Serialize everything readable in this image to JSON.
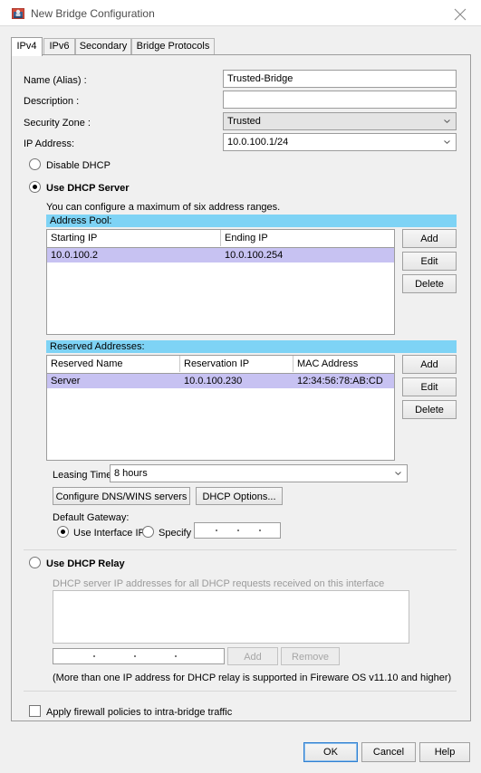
{
  "window": {
    "title": "New Bridge Configuration",
    "icon": "bridge-app-icon",
    "close_icon": "close-icon"
  },
  "tabs": [
    {
      "label": "IPv4",
      "active": true
    },
    {
      "label": "IPv6",
      "active": false
    },
    {
      "label": "Secondary",
      "active": false
    },
    {
      "label": "Bridge Protocols",
      "active": false
    }
  ],
  "form": {
    "name_label": "Name (Alias) :",
    "name_value": "Trusted-Bridge",
    "description_label": "Description :",
    "description_value": "",
    "security_zone_label": "Security Zone :",
    "security_zone_value": "Trusted",
    "ip_address_label": "IP Address:",
    "ip_address_value": "10.0.100.1/24"
  },
  "dhcp_mode": {
    "disable_label": "Disable DHCP",
    "disable_selected": false,
    "server_label": "Use DHCP Server",
    "server_selected": true,
    "relay_label": "Use DHCP Relay",
    "relay_selected": false
  },
  "dhcp_server": {
    "hint": "You can configure a maximum of six address ranges.",
    "address_pool": {
      "section_title": "Address Pool:",
      "columns": [
        "Starting IP",
        "Ending IP"
      ],
      "rows": [
        {
          "starting_ip": "10.0.100.2",
          "ending_ip": "10.0.100.254"
        }
      ],
      "buttons": [
        "Add",
        "Edit",
        "Delete"
      ]
    },
    "reserved_addresses": {
      "section_title": "Reserved Addresses:",
      "columns": [
        "Reserved Name",
        "Reservation IP",
        "MAC Address"
      ],
      "rows": [
        {
          "name": "Server",
          "reservation_ip": "10.0.100.230",
          "mac": "12:34:56:78:AB:CD"
        }
      ],
      "buttons": [
        "Add",
        "Edit",
        "Delete"
      ]
    },
    "leasing_time_label": "Leasing Time",
    "leasing_time_value": "8 hours",
    "dns_wins_button": "Configure DNS/WINS servers",
    "dhcp_options_button": "DHCP Options...",
    "default_gateway_label": "Default Gateway:",
    "gateway_use_interface_label": "Use Interface IP",
    "gateway_use_interface_selected": true,
    "gateway_specify_label": "Specify",
    "gateway_specify_selected": false,
    "gateway_specify_value": ""
  },
  "dhcp_relay": {
    "hint": "DHCP server IP addresses for all DHCP requests received on this interface",
    "list_items": [],
    "entry_value": "",
    "add_button": "Add",
    "remove_button": "Remove",
    "note": "(More than one IP address for DHCP relay is supported in Fireware OS v11.10 and higher)"
  },
  "options": {
    "apply_firewall_label": "Apply firewall policies to intra-bridge traffic",
    "apply_firewall_checked": false
  },
  "footer": {
    "ok": "OK",
    "cancel": "Cancel",
    "help": "Help"
  },
  "colors": {
    "section_header": "#7ed3f5",
    "row_selected": "#c7c2f2",
    "focus_blue": "#2f7fd1"
  }
}
